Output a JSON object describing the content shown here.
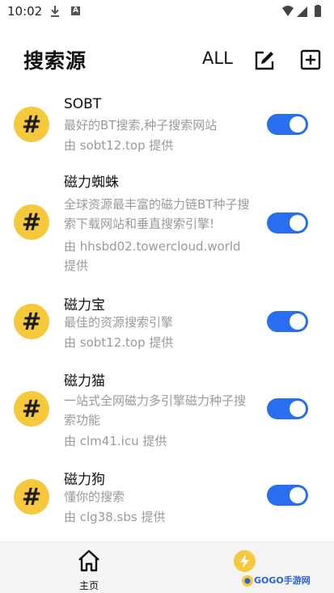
{
  "status_bar": {
    "time": "10:02"
  },
  "header": {
    "title": "搜索源",
    "all_label": "ALL"
  },
  "sources": [
    {
      "icon_glyph": "#",
      "name": "SOBT",
      "desc": "最好的BT搜索,种子搜索网站",
      "provider": "由 sobt12.top 提供",
      "enabled": true
    },
    {
      "icon_glyph": "#",
      "name": "磁力蜘蛛",
      "desc": "全球资源最丰富的磁力链BT种子搜索下载网站和垂直搜索引擎!",
      "provider": "由 hhsbd02.towercloud.world 提供",
      "enabled": true
    },
    {
      "icon_glyph": "#",
      "name": "磁力宝",
      "desc": "最佳的资源搜索引擎",
      "provider": "由 sobt12.top 提供",
      "enabled": true
    },
    {
      "icon_glyph": "#",
      "name": "磁力猫",
      "desc": "一站式全网磁力多引擎磁力种子搜索功能",
      "provider": "由 clm41.icu 提供",
      "enabled": true
    },
    {
      "icon_glyph": "#",
      "name": "磁力狗",
      "desc": "懂你的搜索",
      "provider": "由 clg38.sbs 提供",
      "enabled": true
    }
  ],
  "bottom_nav": {
    "home_label": "主页"
  },
  "watermark": {
    "text": "GOGO手游网"
  },
  "colors": {
    "accent": "#2a6ef0",
    "avatar": "#f6c93d",
    "secondary_text": "#9a9a9a"
  },
  "icons": [
    "download-icon",
    "a-notification-icon",
    "wifi-icon",
    "signal-icon",
    "battery-icon",
    "edit-icon",
    "add-box-icon",
    "home-icon",
    "lightning-icon"
  ]
}
